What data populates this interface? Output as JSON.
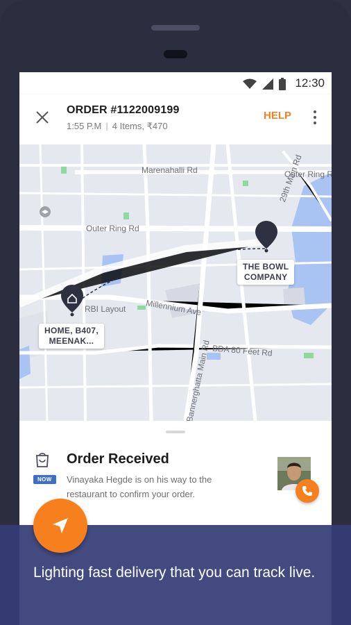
{
  "status_bar": {
    "time": "12:30",
    "icons": [
      "wifi-icon",
      "signal-icon",
      "battery-icon"
    ]
  },
  "header": {
    "title": "ORDER #1122009199",
    "time": "1:55 P.M",
    "separator": "|",
    "summary": "4 Items, ₹470",
    "help_label": "HELP"
  },
  "map": {
    "roads": [
      "Marenahalli Rd",
      "Outer Ring Rd",
      "Outer Ring Rd",
      "29th Main Rd",
      "RBI Layout",
      "Millennium Ave",
      "BDA 80 Feet Rd",
      "Bannerghatta Main Rd"
    ],
    "home_label_line1": "HOME, B407,",
    "home_label_line2": "MEENAK...",
    "restaurant_label_line1": "THE BOWL",
    "restaurant_label_line2": "COMPANY"
  },
  "order_status": {
    "badge": "NOW",
    "title": "Order Received",
    "description": "Vinayaka Hegde is on his way to the restaurant to confirm your order."
  },
  "promo": {
    "headline": "Lighting fast delivery that you can track live."
  },
  "colors": {
    "accent": "#f7801e",
    "badge": "#3e6fc8",
    "overlay": "#343c76",
    "pin": "#2e3142"
  }
}
